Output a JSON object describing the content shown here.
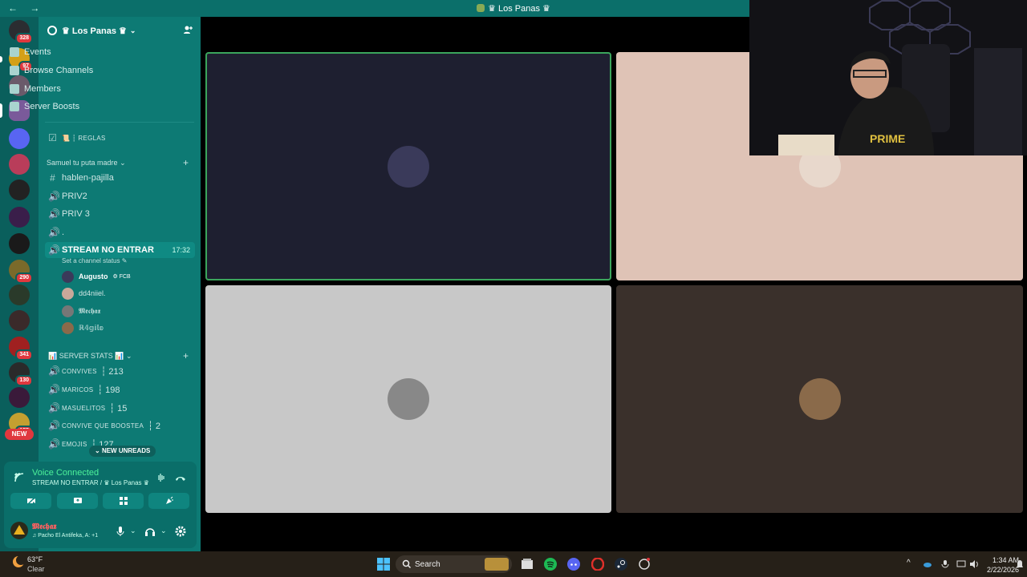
{
  "window": {
    "title": "♛ Los Panas ♛",
    "nav": "← →"
  },
  "guilds": [
    {
      "badge": "328",
      "color": "#2b2d31"
    },
    {
      "badge": "97",
      "color": "#d4a017"
    },
    {
      "badge": "",
      "color": "#6a5a6a"
    },
    {
      "badge": "",
      "color": "#7a5a9a"
    },
    {
      "badge": "",
      "color": "#5865f2"
    },
    {
      "badge": "",
      "color": "#b93d5a"
    },
    {
      "badge": "",
      "color": "#222"
    },
    {
      "badge": "",
      "color": "#3a1e4a"
    },
    {
      "badge": "",
      "color": "#1a1a1a"
    },
    {
      "badge": "290",
      "color": "#7a6a2a"
    },
    {
      "badge": "",
      "color": "#2a3a2a"
    },
    {
      "badge": "",
      "color": "#3a2a2a"
    },
    {
      "badge": "341",
      "color": "#a02020"
    },
    {
      "badge": "130",
      "color": "#2a2a2a"
    },
    {
      "badge": "",
      "color": "#3a1a3a"
    },
    {
      "badge": "155",
      "color": "#c4a030"
    }
  ],
  "new_label": "NEW",
  "server": {
    "name": "♛ Los Panas ♛",
    "menu": [
      "Events",
      "Browse Channels",
      "Members",
      "Server Boosts"
    ],
    "rules": "📜 ┆ REGLAS",
    "category1": "Samuel tu puta madre",
    "channels1": [
      {
        "name": "hablen-pajilla",
        "icon": "#"
      },
      {
        "name": "PRIV2",
        "icon": "🔊"
      },
      {
        "name": "PRIV 3",
        "icon": "🔊"
      },
      {
        "name": ".",
        "icon": "🔊"
      }
    ],
    "active_channel": {
      "name": "STREAM NO ENTRAR",
      "time": "17:32",
      "status": "Set a channel status"
    },
    "voice_users": [
      {
        "name": "Augusto",
        "tag": "⚙ FCB",
        "color": "#3a3a5a"
      },
      {
        "name": "dd4niiel.",
        "tag": "",
        "color": "#c9a89a"
      },
      {
        "name": "𝕸𝖊𝖈𝖍𝖆𝖝",
        "tag": "",
        "color": "#777"
      },
      {
        "name": "ℝ𝟜𝕘𝕚𝕝𝕠",
        "tag": "",
        "color": "#8a6a4a"
      }
    ],
    "category2": "📊 SERVER STATS 📊",
    "stats": [
      {
        "label": "CONVIVES",
        "value": "┆ 213"
      },
      {
        "label": "MARICOS",
        "value": "┆ 198"
      },
      {
        "label": "MASUELITOS",
        "value": "┆ 15"
      },
      {
        "label": "CONVIVE QUE BOOSTEA",
        "value": "┆ 2"
      },
      {
        "label": "EMOJIS",
        "value": "┆ 127"
      }
    ],
    "new_unreads": "NEW UNREADS"
  },
  "voice_panel": {
    "title": "Voice Connected",
    "subtitle": "STREAM NO ENTRAR / ♛ Los Panas ♛"
  },
  "user": {
    "name": "𝕸𝖊𝖈𝖍𝖆𝖝",
    "status": "♫ Pacho El Antifeka, A: +1"
  },
  "tiles": [
    {
      "bg": "#1e1f30",
      "avatar": "#3a3a5a",
      "speaking": true
    },
    {
      "bg": "#dfc3b6",
      "avatar": "#e8d8cc",
      "speaking": false
    },
    {
      "bg": "#c8c8c8",
      "avatar": "#888",
      "speaking": false
    },
    {
      "bg": "#3a302b",
      "avatar": "#8a6a4a",
      "speaking": false
    }
  ],
  "taskbar": {
    "weather_temp": "63°F",
    "weather_desc": "Clear",
    "search": "Search",
    "time": "1:34 AM",
    "date": "2/22/2026"
  }
}
